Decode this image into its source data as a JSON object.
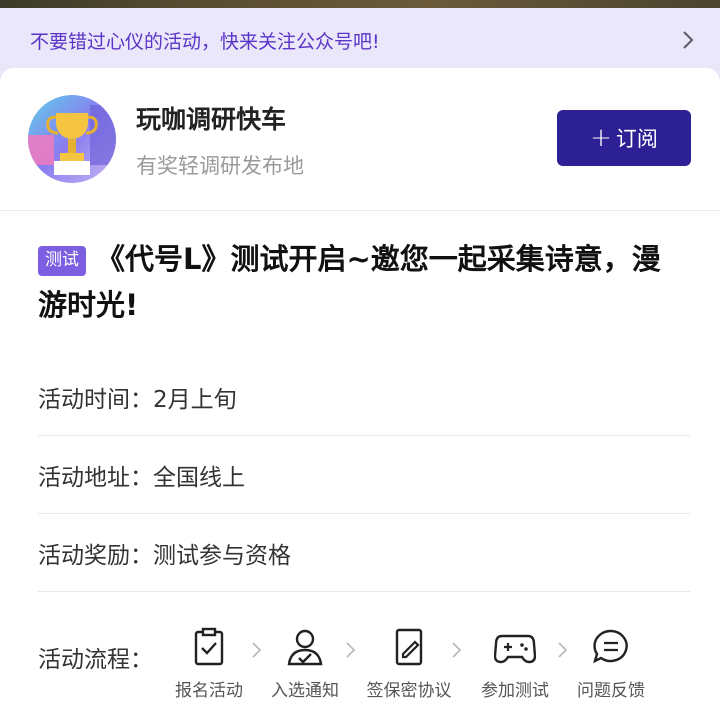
{
  "notice": {
    "text": "不要错过心仪的活动，快来关注公众号吧!",
    "arrow_icon": "chevron-right-icon"
  },
  "account": {
    "name": "玩咖调研快车",
    "description": "有奖轻调研发布地",
    "avatar_icon": "trophy-avatar-icon",
    "subscribe_plus": "+",
    "subscribe_label": "订阅"
  },
  "event": {
    "tag": "测试",
    "title": "《代号L》测试开启~邀您一起采集诗意，漫游时光!"
  },
  "details": [
    {
      "label": "活动时间：",
      "value": "2月上旬"
    },
    {
      "label": "活动地址：",
      "value": "全国线上"
    },
    {
      "label": "活动奖励：",
      "value": "测试参与资格"
    }
  ],
  "process": {
    "label": "活动流程：",
    "steps": [
      {
        "label": "报名活动",
        "icon": "clipboard-check-icon"
      },
      {
        "label": "入选通知",
        "icon": "user-check-icon"
      },
      {
        "label": "签保密协议",
        "icon": "document-sign-icon"
      },
      {
        "label": "参加测试",
        "icon": "gamepad-icon"
      },
      {
        "label": "问题反馈",
        "icon": "chat-bubble-icon"
      }
    ]
  },
  "colors": {
    "accent": "#2c2094",
    "notice_bg": "#ebe7fb",
    "notice_text": "#5a34c7",
    "tag_bg": "#7b5fe0"
  }
}
